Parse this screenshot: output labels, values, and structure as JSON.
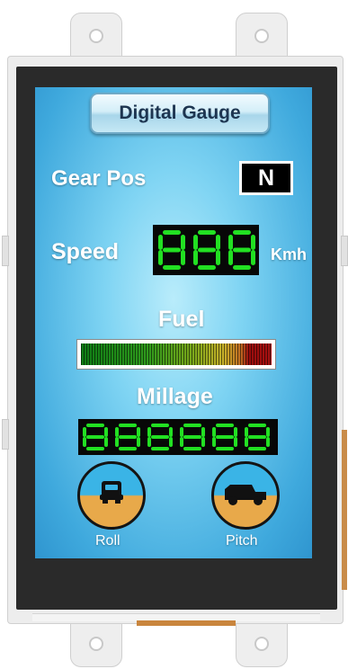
{
  "title": "Digital Gauge",
  "gear": {
    "label": "Gear Pos",
    "value": "N"
  },
  "speed": {
    "label": "Speed",
    "digits": "888",
    "unit": "Kmh"
  },
  "fuel": {
    "label": "Fuel",
    "level": 1.0
  },
  "mileage": {
    "label": "Millage",
    "digits": "888888"
  },
  "roll": {
    "label": "Roll",
    "icon": "vehicle-rear-icon"
  },
  "pitch": {
    "label": "Pitch",
    "icon": "vehicle-side-icon"
  },
  "colors": {
    "segment_on": "#22e022",
    "screen_bg": "#3fa9dd",
    "sky": "#3ab4e6",
    "ground": "#e8a94a"
  }
}
